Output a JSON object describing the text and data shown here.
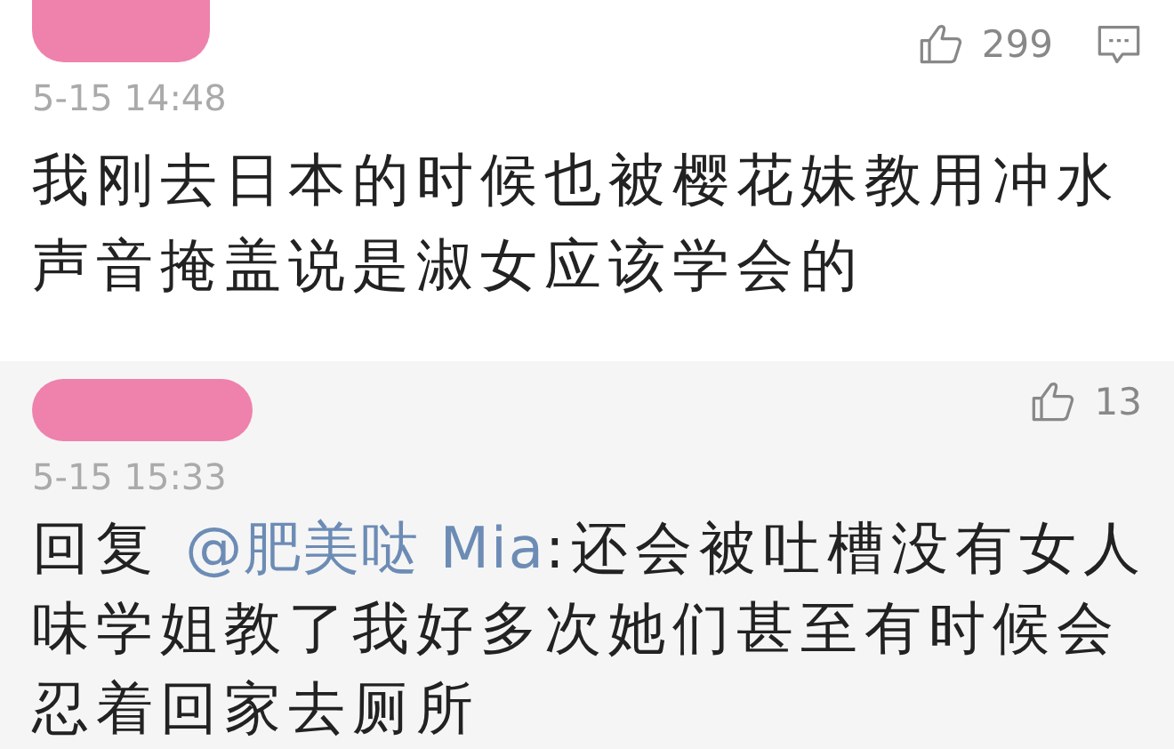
{
  "comments": [
    {
      "author": {
        "redacted": true
      },
      "highlighted": false,
      "likes": "299",
      "show_reply_icon": true,
      "time": "5-15 14:48",
      "body": {
        "text": "我刚去日本的时候也被樱花妹教用冲水声音掩盖说是淑女应该学会的"
      }
    },
    {
      "author": {
        "redacted": true
      },
      "highlighted": true,
      "likes": "13",
      "show_reply_icon": false,
      "time": "5-15 15:33",
      "body": {
        "prefix": "回复 ",
        "mention": "@肥美哒 Mia",
        "text": ":还会被吐槽没有女人味学姐教了我好多次她们甚至有时候会忍着回家去厕所"
      }
    }
  ]
}
